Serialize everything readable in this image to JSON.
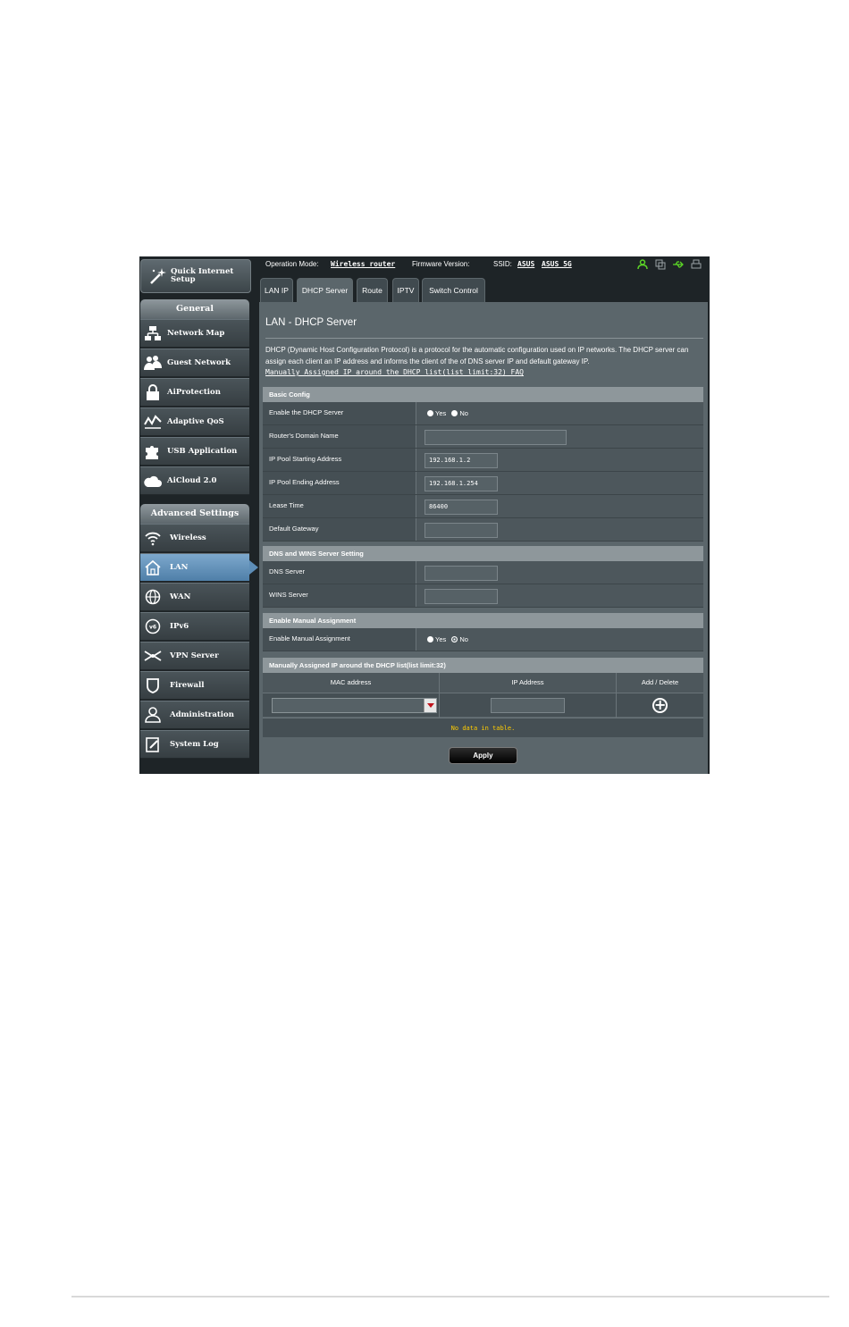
{
  "sidebar": {
    "quick_setup": "Quick Internet Setup",
    "general_header": "General",
    "general_items": [
      {
        "label": "Network Map",
        "icon": "network-map-icon"
      },
      {
        "label": "Guest Network",
        "icon": "guest-network-icon"
      },
      {
        "label": "AiProtection",
        "icon": "lock-icon"
      },
      {
        "label": "Adaptive QoS",
        "icon": "qos-icon"
      },
      {
        "label": "USB Application",
        "icon": "puzzle-icon"
      },
      {
        "label": "AiCloud 2.0",
        "icon": "cloud-icon"
      }
    ],
    "advanced_header": "Advanced Settings",
    "advanced_items": [
      {
        "label": "Wireless",
        "icon": "wifi-icon"
      },
      {
        "label": "LAN",
        "icon": "home-icon",
        "active": true
      },
      {
        "label": "WAN",
        "icon": "globe-icon"
      },
      {
        "label": "IPv6",
        "icon": "ipv6-globe-icon"
      },
      {
        "label": "VPN Server",
        "icon": "vpn-icon"
      },
      {
        "label": "Firewall",
        "icon": "shield-icon"
      },
      {
        "label": "Administration",
        "icon": "user-icon"
      },
      {
        "label": "System Log",
        "icon": "log-icon"
      }
    ]
  },
  "topbar": {
    "op_mode_label": "Operation Mode:",
    "op_mode_value": "Wireless router",
    "firmware_label": "Firmware Version:",
    "ssid_label": "SSID:",
    "ssid_1": "ASUS",
    "ssid_2": "ASUS_5G",
    "status_icons": [
      "user-status-icon",
      "copy-icon",
      "usb-icon",
      "printer-icon"
    ]
  },
  "tabs": [
    {
      "label": "LAN IP"
    },
    {
      "label": "DHCP Server",
      "active": true
    },
    {
      "label": "Route"
    },
    {
      "label": "IPTV"
    },
    {
      "label": "Switch Control"
    }
  ],
  "main": {
    "title": "LAN - DHCP Server",
    "description": "DHCP (Dynamic Host Configuration Protocol) is a protocol for the automatic configuration used on IP networks. The DHCP server can assign each client an IP address and informs the client of the of DNS server IP and default gateway IP.",
    "faq_link": "Manually Assigned IP around the DHCP list(list limit:32) FAQ",
    "basic_config": {
      "header": "Basic Config",
      "enable_dhcp_label": "Enable the DHCP Server",
      "yes": "Yes",
      "no": "No",
      "enable_dhcp_value": "Yes",
      "domain_label": "Router's Domain Name",
      "domain_value": "",
      "pool_start_label": "IP Pool Starting Address",
      "pool_start_value": "192.168.1.2",
      "pool_end_label": "IP Pool Ending Address",
      "pool_end_value": "192.168.1.254",
      "lease_label": "Lease Time",
      "lease_value": "86400",
      "gateway_label": "Default Gateway",
      "gateway_value": ""
    },
    "dns_wins": {
      "header": "DNS and WINS Server Setting",
      "dns_label": "DNS Server",
      "dns_value": "",
      "wins_label": "WINS Server",
      "wins_value": ""
    },
    "manual": {
      "header": "Enable Manual Assignment",
      "label": "Enable Manual Assignment",
      "yes": "Yes",
      "no": "No",
      "value": "No"
    },
    "manual_list": {
      "header": "Manually Assigned IP around the DHCP list(list limit:32)",
      "columns": [
        "MAC address",
        "IP Address",
        "Add / Delete"
      ],
      "mac_value": "",
      "ip_value": "",
      "empty_text": "No data in table."
    },
    "apply_label": "Apply"
  }
}
